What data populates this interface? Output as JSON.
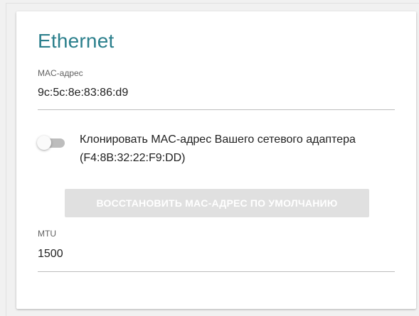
{
  "card": {
    "title": "Ethernet"
  },
  "mac_field": {
    "label": "MAC-адрес",
    "value": "9c:5c:8e:83:86:d9"
  },
  "clone_toggle": {
    "label": "Клонировать MAC-адрес Вашего сетевого адаптера (F4:8B:32:22:F9:DD)",
    "checked": false
  },
  "restore_button": {
    "label": "ВОССТАНОВИТЬ MAC-АДРЕС ПО УМОЛЧАНИЮ",
    "disabled": true
  },
  "mtu_field": {
    "label": "MTU",
    "value": "1500"
  },
  "colors": {
    "title": "#2b7f8c",
    "background": "#f1f1f1",
    "card": "#ffffff",
    "disabled_button": "#e0e0e0",
    "toggle_track_off": "#bdbdbd"
  }
}
